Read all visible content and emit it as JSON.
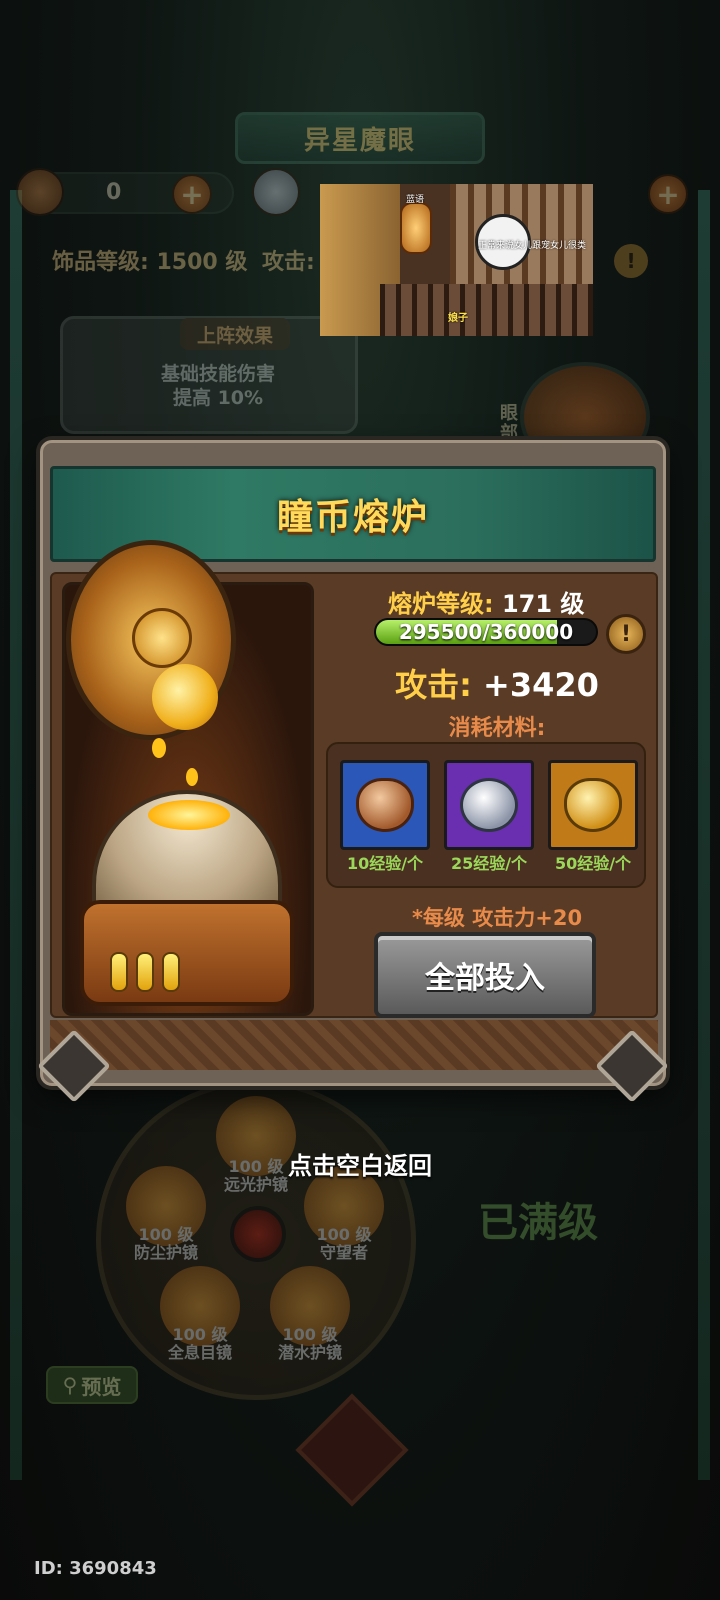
{
  "game": {
    "title": "异星魔眼",
    "resources": [
      {
        "icon": "copper-coin-icon",
        "count": "0"
      },
      {
        "icon": "silver-coin-icon",
        "count": ""
      }
    ],
    "accessory_level": "饰品等级: 1500 级",
    "attack_partial": "攻击:",
    "effect_title": "上阵效果",
    "effect_text_1": "基础技能伤害",
    "effect_text_2": "提高 10%",
    "eye_side_label": "眼部",
    "wheel": [
      {
        "level": "100 级",
        "name": "远光护镜"
      },
      {
        "level": "100 级",
        "name": "防尘护镜"
      },
      {
        "level": "100 级",
        "name": "守望者"
      },
      {
        "level": "100 级",
        "name": "全息目镜"
      },
      {
        "level": "100 级",
        "name": "潜水护镜"
      }
    ],
    "maxed_label": "已满级",
    "preview_label": "预览",
    "user_id": "ID: 3690843",
    "tap_hint": "点击空白返回"
  },
  "video_overlay": {
    "label_small": "蓝语",
    "caption_top": "正常来说女儿跟宠女儿很类",
    "caption_bottom": "娘子"
  },
  "modal": {
    "title": "瞳币熔炉",
    "furnace_level_label": "熔炉等级:",
    "furnace_level_value": "171 级",
    "exp_text": "295500/360000",
    "exp_progress": 0.8208,
    "attack_label": "攻击:",
    "attack_value": "+3420",
    "consume_label": "消耗材料:",
    "materials": [
      {
        "name": "copper",
        "exp": "10经验/个",
        "bg": "#2a57b8"
      },
      {
        "name": "silver",
        "exp": "25经验/个",
        "bg": "#6a2fb0"
      },
      {
        "name": "gold",
        "exp": "50经验/个",
        "bg": "#c07a18"
      }
    ],
    "per_level_note": "*每级 攻击力+20",
    "invest_all_label": "全部投入",
    "info_icon": "exclamation-icon"
  }
}
